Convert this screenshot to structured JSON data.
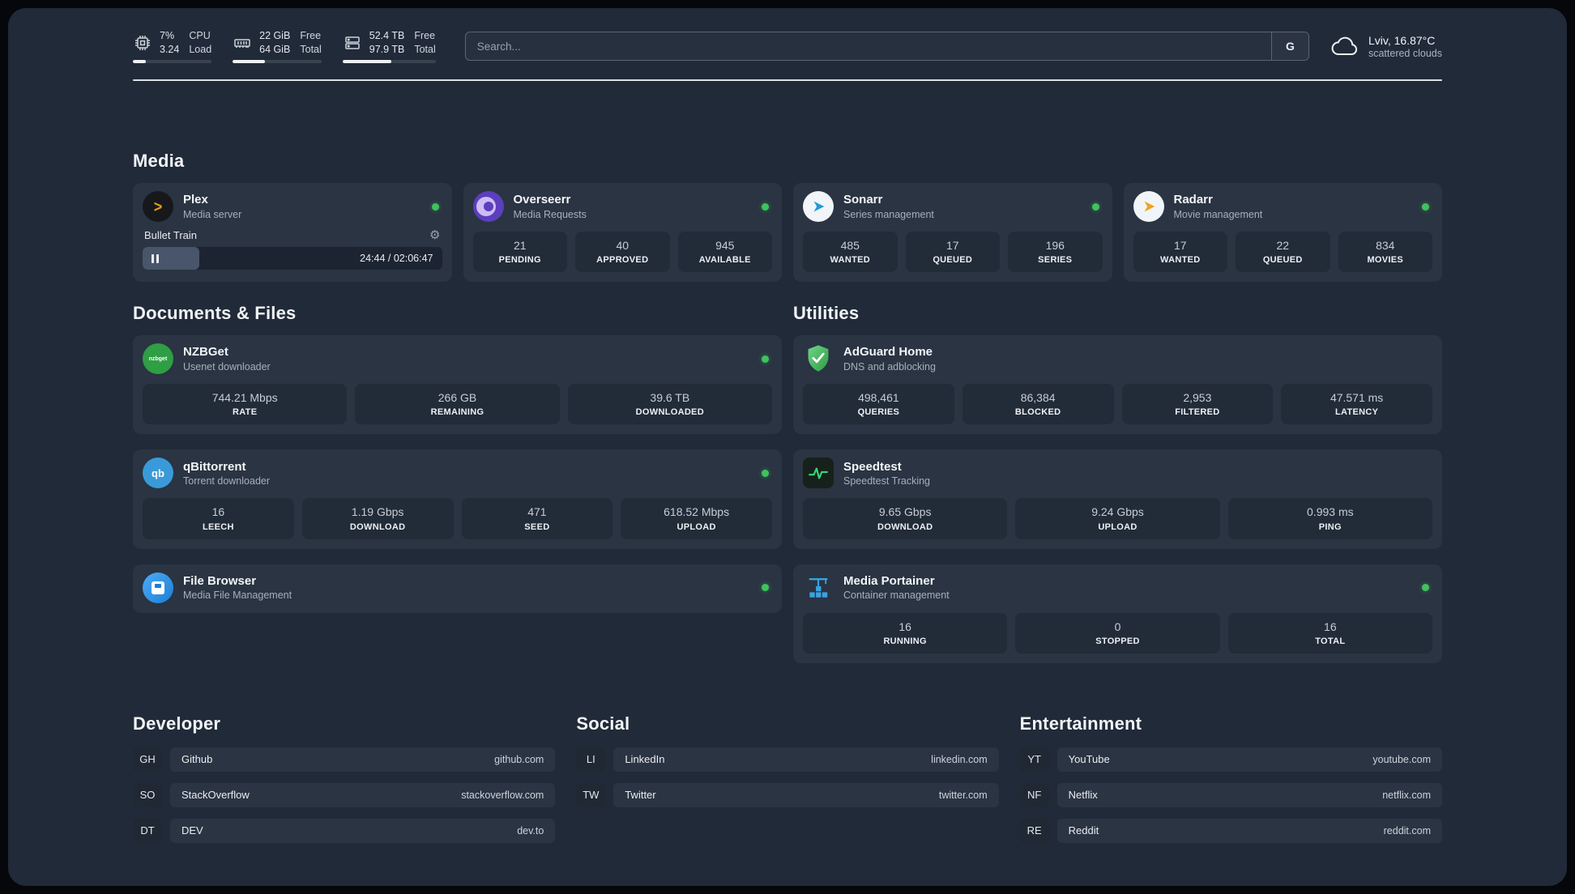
{
  "header": {
    "cpu": {
      "v1": "7%",
      "v2": "3.24",
      "l1": "CPU",
      "l2": "Load",
      "progress": 16
    },
    "ram": {
      "v1": "22 GiB",
      "v2": "64 GiB",
      "l1": "Free",
      "l2": "Total",
      "progress": 36
    },
    "disk": {
      "v1": "52.4 TB",
      "v2": "97.9 TB",
      "l1": "Free",
      "l2": "Total",
      "progress": 52
    },
    "search": {
      "placeholder": "Search...",
      "engine": "G"
    },
    "weather": {
      "location": "Lviv, 16.87°C",
      "condition": "scattered clouds"
    }
  },
  "media": {
    "title": "Media",
    "plex": {
      "name": "Plex",
      "subtitle": "Media server",
      "now_playing": "Bullet Train",
      "time": "24:44 / 02:06:47",
      "progress": 19
    },
    "overseerr": {
      "name": "Overseerr",
      "subtitle": "Media Requests",
      "stats": [
        {
          "value": "21",
          "label": "PENDING"
        },
        {
          "value": "40",
          "label": "APPROVED"
        },
        {
          "value": "945",
          "label": "AVAILABLE"
        }
      ]
    },
    "sonarr": {
      "name": "Sonarr",
      "subtitle": "Series management",
      "stats": [
        {
          "value": "485",
          "label": "WANTED"
        },
        {
          "value": "17",
          "label": "QUEUED"
        },
        {
          "value": "196",
          "label": "SERIES"
        }
      ]
    },
    "radarr": {
      "name": "Radarr",
      "subtitle": "Movie management",
      "stats": [
        {
          "value": "17",
          "label": "WANTED"
        },
        {
          "value": "22",
          "label": "QUEUED"
        },
        {
          "value": "834",
          "label": "MOVIES"
        }
      ]
    }
  },
  "documents": {
    "title": "Documents & Files",
    "nzbget": {
      "name": "NZBGet",
      "subtitle": "Usenet downloader",
      "stats": [
        {
          "value": "744.21 Mbps",
          "label": "RATE"
        },
        {
          "value": "266 GB",
          "label": "REMAINING"
        },
        {
          "value": "39.6 TB",
          "label": "DOWNLOADED"
        }
      ]
    },
    "qbittorrent": {
      "name": "qBittorrent",
      "subtitle": "Torrent downloader",
      "stats": [
        {
          "value": "16",
          "label": "LEECH"
        },
        {
          "value": "1.19 Gbps",
          "label": "DOWNLOAD"
        },
        {
          "value": "471",
          "label": "SEED"
        },
        {
          "value": "618.52 Mbps",
          "label": "UPLOAD"
        }
      ]
    },
    "filebrowser": {
      "name": "File Browser",
      "subtitle": "Media File Management"
    }
  },
  "utilities": {
    "title": "Utilities",
    "adguard": {
      "name": "AdGuard Home",
      "subtitle": "DNS and adblocking",
      "stats": [
        {
          "value": "498,461",
          "label": "QUERIES"
        },
        {
          "value": "86,384",
          "label": "BLOCKED"
        },
        {
          "value": "2,953",
          "label": "FILTERED"
        },
        {
          "value": "47.571 ms",
          "label": "LATENCY"
        }
      ]
    },
    "speedtest": {
      "name": "Speedtest",
      "subtitle": "Speedtest Tracking",
      "stats": [
        {
          "value": "9.65 Gbps",
          "label": "DOWNLOAD"
        },
        {
          "value": "9.24 Gbps",
          "label": "UPLOAD"
        },
        {
          "value": "0.993 ms",
          "label": "PING"
        }
      ]
    },
    "portainer": {
      "name": "Media Portainer",
      "subtitle": "Container management",
      "stats": [
        {
          "value": "16",
          "label": "RUNNING"
        },
        {
          "value": "0",
          "label": "STOPPED"
        },
        {
          "value": "16",
          "label": "TOTAL"
        }
      ]
    }
  },
  "links": [
    {
      "title": "Developer",
      "items": [
        {
          "abbr": "GH",
          "name": "Github",
          "url": "github.com"
        },
        {
          "abbr": "SO",
          "name": "StackOverflow",
          "url": "stackoverflow.com"
        },
        {
          "abbr": "DT",
          "name": "DEV",
          "url": "dev.to"
        }
      ]
    },
    {
      "title": "Social",
      "items": [
        {
          "abbr": "LI",
          "name": "LinkedIn",
          "url": "linkedin.com"
        },
        {
          "abbr": "TW",
          "name": "Twitter",
          "url": "twitter.com"
        }
      ]
    },
    {
      "title": "Entertainment",
      "items": [
        {
          "abbr": "YT",
          "name": "YouTube",
          "url": "youtube.com"
        },
        {
          "abbr": "NF",
          "name": "Netflix",
          "url": "netflix.com"
        },
        {
          "abbr": "RE",
          "name": "Reddit",
          "url": "reddit.com"
        }
      ]
    }
  ],
  "icons": {
    "plex_glyph": ">",
    "gear": "⚙",
    "nzbget_text": "nzbget",
    "qbittorrent_text": "qb"
  },
  "colors": {
    "background": "#212a38",
    "card": "#2a3442",
    "tile": "#222b38",
    "status_online": "#3fc35c",
    "plex_accent": "#e5a00d",
    "divider": "#dbe0e6"
  }
}
